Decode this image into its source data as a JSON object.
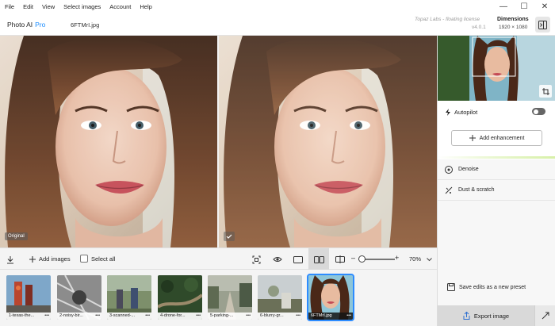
{
  "menu": [
    "File",
    "Edit",
    "View",
    "Select images",
    "Account",
    "Help"
  ],
  "window_controls": {
    "minimize": "—",
    "maximize": "☐",
    "close": "✕"
  },
  "header": {
    "app_name": "Photo AI",
    "app_tier": "Pro",
    "file_name": "6FTMrI.jpg",
    "license": "Topaz Labs - floating license",
    "version": "v4.0.1",
    "dimensions_label": "Dimensions",
    "dimensions_value": "1920 × 1080"
  },
  "preview": {
    "original_badge": "Original"
  },
  "toolbar": {
    "add_images": "Add images",
    "select_all": "Select all",
    "zoom": "70%"
  },
  "thumbnails": [
    {
      "name": "1-texas-the...",
      "selected": false
    },
    {
      "name": "2-noisy-bir...",
      "selected": false
    },
    {
      "name": "3-scanned-...",
      "selected": false
    },
    {
      "name": "4-drone-for...",
      "selected": false
    },
    {
      "name": "5-parking-...",
      "selected": false
    },
    {
      "name": "6-blurry-gr...",
      "selected": false
    },
    {
      "name": "6FTMrI.jpg",
      "selected": true
    }
  ],
  "panel": {
    "autopilot": "Autopilot",
    "autopilot_on": false,
    "add_enhancement": "Add enhancement",
    "enhancements": [
      "Denoise",
      "Dust & scratch"
    ],
    "save_preset": "Save edits as a new preset",
    "export": "Export image"
  },
  "colors": {
    "accent": "#2d8cff",
    "pro": "#1a8cff",
    "panel_bg": "#f7f7f7"
  }
}
